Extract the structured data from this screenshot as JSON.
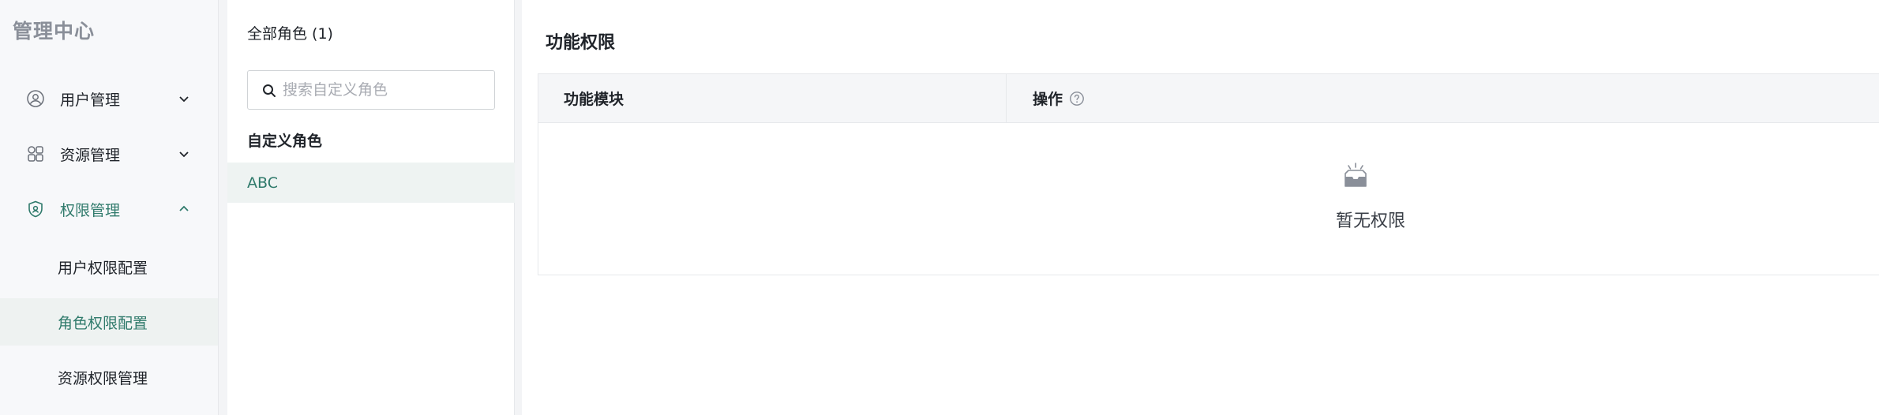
{
  "app": {
    "title": "管理中心"
  },
  "sidebar": {
    "items": [
      {
        "label": "用户管理",
        "icon": "user-circle-icon",
        "expanded": false
      },
      {
        "label": "资源管理",
        "icon": "grid-icon",
        "expanded": false
      },
      {
        "label": "权限管理",
        "icon": "shield-icon",
        "expanded": true,
        "active": true
      }
    ],
    "sub_items": [
      {
        "label": "用户权限配置",
        "active": false
      },
      {
        "label": "角色权限配置",
        "active": true
      },
      {
        "label": "资源权限管理",
        "active": false
      }
    ]
  },
  "roles": {
    "header": "全部角色 (1)",
    "search_placeholder": "搜索自定义角色",
    "search_value": "",
    "section_title": "自定义角色",
    "items": [
      {
        "label": "ABC",
        "selected": true
      }
    ]
  },
  "main": {
    "title": "功能权限",
    "columns": [
      "功能模块",
      "操作"
    ],
    "empty_text": "暂无权限"
  },
  "colors": {
    "accent": "#2f7a6b",
    "active_bg": "#eef3f2",
    "header_bg": "#f5f6f8",
    "border": "#e6e8eb"
  }
}
